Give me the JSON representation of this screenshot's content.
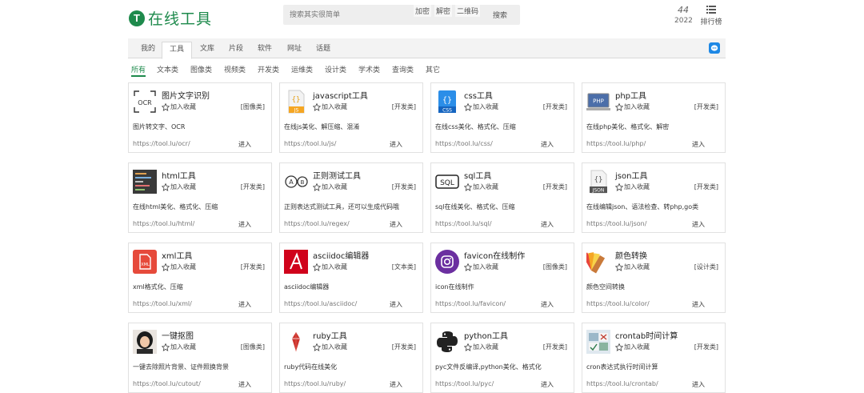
{
  "header": {
    "logo_glyph": "T",
    "logo_text": "在线工具",
    "search_placeholder": "搜索其实很简单",
    "search_tags": [
      "加密",
      "解密",
      "二维码"
    ],
    "search_button": "搜索",
    "stat_number": "44",
    "stat_year": "2022",
    "rank_label": "排行榜"
  },
  "tabs": [
    {
      "label": "我的",
      "active": false
    },
    {
      "label": "工具",
      "active": true
    },
    {
      "label": "文库",
      "active": false
    },
    {
      "label": "片段",
      "active": false
    },
    {
      "label": "软件",
      "active": false
    },
    {
      "label": "网址",
      "active": false
    },
    {
      "label": "话题",
      "active": false
    }
  ],
  "categories": [
    {
      "label": "所有",
      "active": true
    },
    {
      "label": "文本类"
    },
    {
      "label": "图像类"
    },
    {
      "label": "视频类"
    },
    {
      "label": "开发类"
    },
    {
      "label": "运维类"
    },
    {
      "label": "设计类"
    },
    {
      "label": "学术类"
    },
    {
      "label": "查询类"
    },
    {
      "label": "其它"
    }
  ],
  "fav_label": "加入收藏",
  "enter_label": "进入",
  "cards": [
    {
      "title": "图片文字识别",
      "category": "[图像类]",
      "desc": "图片转文字、OCR",
      "url": "https://tool.lu/ocr/",
      "icon": "ocr-icon",
      "icon_text": "OCR"
    },
    {
      "title": "javascript工具",
      "category": "[开发类]",
      "desc": "在线js美化、解压缩、混淆",
      "url": "https://tool.lu/js/",
      "icon": "js-file-icon",
      "icon_text": "JS"
    },
    {
      "title": "css工具",
      "category": "[开发类]",
      "desc": "在线css美化、格式化、压缩",
      "url": "https://tool.lu/css/",
      "icon": "css-file-icon",
      "icon_text": "CSS"
    },
    {
      "title": "php工具",
      "category": "[开发类]",
      "desc": "在线php美化、格式化、解密",
      "url": "https://tool.lu/php/",
      "icon": "php-icon",
      "icon_text": "PHP"
    },
    {
      "title": "html工具",
      "category": "[开发类]",
      "desc": "在线html美化、格式化、压缩",
      "url": "https://tool.lu/html/",
      "icon": "html-code-icon",
      "icon_text": ""
    },
    {
      "title": "正则测试工具",
      "category": "[开发类]",
      "desc": "正则表达式测试工具，还可以生成代码哦",
      "url": "https://tool.lu/regex/",
      "icon": "regex-icon",
      "icon_text": ""
    },
    {
      "title": "sql工具",
      "category": "[开发类]",
      "desc": "sql在线美化、格式化、压缩",
      "url": "https://tool.lu/sql/",
      "icon": "sql-icon",
      "icon_text": "SQL"
    },
    {
      "title": "json工具",
      "category": "[开发类]",
      "desc": "在线编辑json、语法检查、转php,go类",
      "url": "https://tool.lu/json/",
      "icon": "json-file-icon",
      "icon_text": "JSON"
    },
    {
      "title": "xml工具",
      "category": "[开发类]",
      "desc": "xml格式化、压缩",
      "url": "https://tool.lu/xml/",
      "icon": "xml-file-icon",
      "icon_text": "XML"
    },
    {
      "title": "asciidoc编辑器",
      "category": "[文本类]",
      "desc": "asciidoc编辑器",
      "url": "https://tool.lu/asciidoc/",
      "icon": "asciidoc-icon",
      "icon_text": ""
    },
    {
      "title": "favicon在线制作",
      "category": "[图像类]",
      "desc": "icon在线制作",
      "url": "https://tool.lu/favicon/",
      "icon": "favicon-camera-icon",
      "icon_text": ""
    },
    {
      "title": "颜色转换",
      "category": "[设计类]",
      "desc": "颜色空间转换",
      "url": "https://tool.lu/color/",
      "icon": "color-swatch-icon",
      "icon_text": ""
    },
    {
      "title": "一键抠图",
      "category": "[图像类]",
      "desc": "一键去除照片背景、证件照换背景",
      "url": "https://tool.lu/cutout/",
      "icon": "portrait-icon",
      "icon_text": ""
    },
    {
      "title": "ruby工具",
      "category": "[开发类]",
      "desc": "ruby代码在线美化",
      "url": "https://tool.lu/ruby/",
      "icon": "ruby-gem-icon",
      "icon_text": ""
    },
    {
      "title": "python工具",
      "category": "[开发类]",
      "desc": "pyc文件反编译,python美化、格式化",
      "url": "https://tool.lu/pyc/",
      "icon": "python-logo-icon",
      "icon_text": ""
    },
    {
      "title": "crontab时间计算",
      "category": "[开发类]",
      "desc": "cron表达式执行时间计算",
      "url": "https://tool.lu/crontab/",
      "icon": "crontab-icon",
      "icon_text": ""
    }
  ]
}
